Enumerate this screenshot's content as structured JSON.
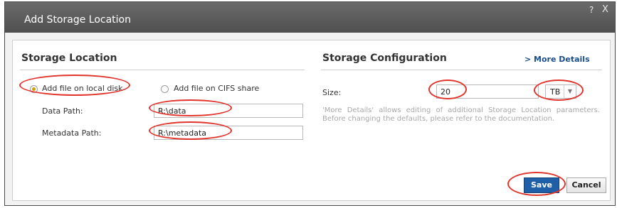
{
  "dialog": {
    "title": "Add Storage Location",
    "help_icon": "?",
    "close_icon": "X"
  },
  "storage_location": {
    "heading": "Storage Location",
    "options": [
      {
        "label": "Add file on local disk",
        "selected": true
      },
      {
        "label": "Add file on CIFS share",
        "selected": false
      }
    ],
    "data_path": {
      "label": "Data Path:",
      "value": "R:\\data"
    },
    "metadata_path": {
      "label": "Metadata Path:",
      "value": "R:\\metadata"
    }
  },
  "storage_configuration": {
    "heading": "Storage Configuration",
    "more_details": "> More Details",
    "size_label": "Size:",
    "size_value": "20",
    "unit": "TB",
    "note": "'More Details' allows editing of additional Storage Location parameters. Before changing the defaults, please refer to the documentation."
  },
  "buttons": {
    "save": "Save",
    "cancel": "Cancel"
  },
  "colors": {
    "accent": "#1f5fa8",
    "annotation": "#e0342c",
    "radio_selected": "#d4a000"
  }
}
